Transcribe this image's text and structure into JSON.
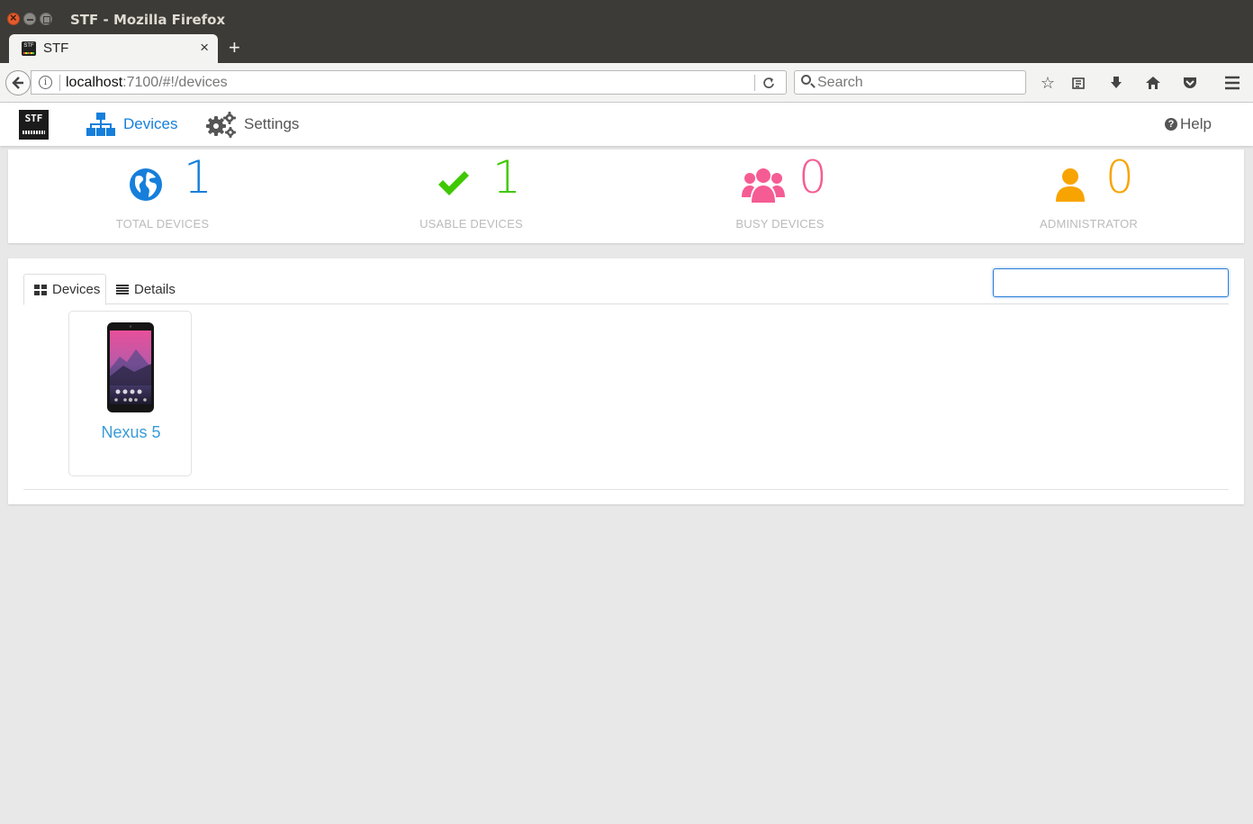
{
  "window": {
    "title": "STF - Mozilla Firefox"
  },
  "browser": {
    "tab_title": "STF",
    "url_host": "localhost",
    "url_path": ":7100/#!/devices",
    "search_placeholder": "Search"
  },
  "nav": {
    "devices_label": "Devices",
    "settings_label": "Settings",
    "help_label": "Help"
  },
  "stats": [
    {
      "value": "1",
      "label": "TOTAL DEVICES",
      "color": "#157fdb"
    },
    {
      "value": "1",
      "label": "USABLE DEVICES",
      "color": "#3fc800"
    },
    {
      "value": "0",
      "label": "BUSY DEVICES",
      "color": "#f55c93"
    },
    {
      "value": "0",
      "label": "ADMINISTRATOR",
      "color": "#f8a400"
    }
  ],
  "view_tabs": {
    "devices": "Devices",
    "details": "Details"
  },
  "filter": {
    "value": ""
  },
  "devices": [
    {
      "name": "Nexus 5"
    }
  ],
  "colors": {
    "accent": "#167fdb",
    "link": "#3a9bd9"
  }
}
